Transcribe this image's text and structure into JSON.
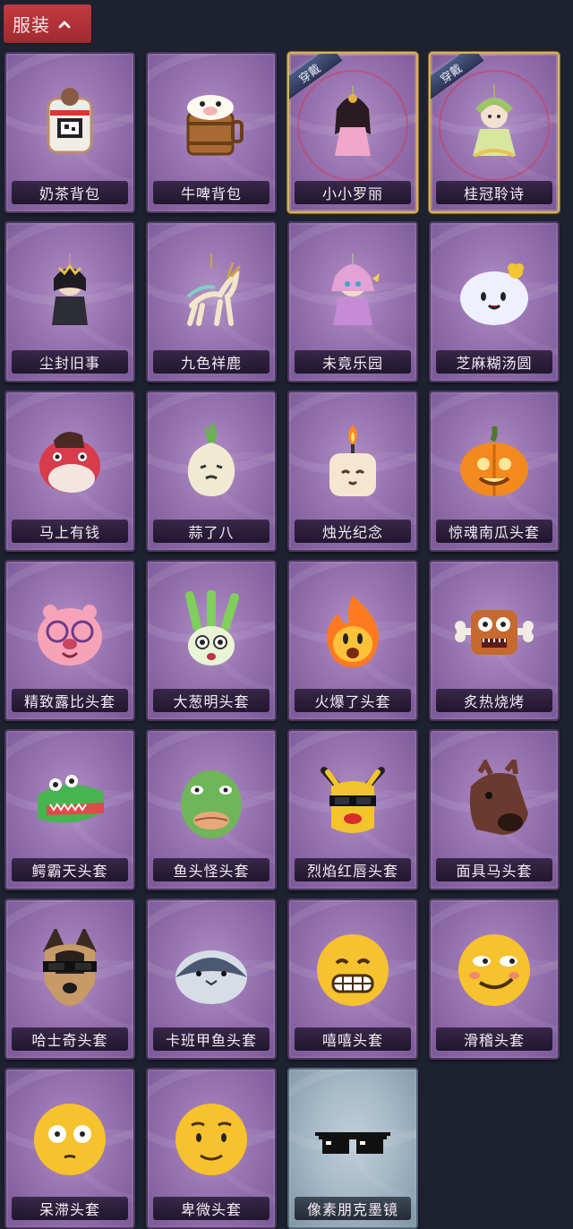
{
  "header": {
    "title": "服装",
    "toggle_icon": "chevron-up-icon"
  },
  "equipped_badge": "穿戴",
  "items": [
    {
      "name": "奶茶背包",
      "icon": "milk-tea-bag-icon",
      "color": "#e2c6a7",
      "equipped": false,
      "tone": "purple"
    },
    {
      "name": "牛啤背包",
      "icon": "beer-barrel-bag-icon",
      "color": "#c88a4a",
      "equipped": false,
      "tone": "purple"
    },
    {
      "name": "小小罗丽",
      "icon": "doll-charm-icon",
      "color": "#f0a7c9",
      "equipped": true,
      "tone": "purple"
    },
    {
      "name": "桂冠聆诗",
      "icon": "laurel-charm-icon",
      "color": "#d8e6a0",
      "equipped": true,
      "tone": "purple"
    },
    {
      "name": "尘封旧事",
      "icon": "gothic-doll-charm-icon",
      "color": "#2d2d35",
      "equipped": false,
      "tone": "purple"
    },
    {
      "name": "九色祥鹿",
      "icon": "deer-charm-icon",
      "color": "#f2e6c9",
      "equipped": false,
      "tone": "purple"
    },
    {
      "name": "未竟乐园",
      "icon": "clown-doll-charm-icon",
      "color": "#c68ad8",
      "equipped": false,
      "tone": "purple"
    },
    {
      "name": "芝麻糊汤圆",
      "icon": "dumpling-charm-icon",
      "color": "#eef0ff",
      "equipped": false,
      "tone": "purple"
    },
    {
      "name": "马上有钱",
      "icon": "horse-head-mask-icon",
      "color": "#d83b4b",
      "equipped": false,
      "tone": "purple"
    },
    {
      "name": "蒜了八",
      "icon": "garlic-mask-icon",
      "color": "#f0ead2",
      "equipped": false,
      "tone": "purple"
    },
    {
      "name": "烛光纪念",
      "icon": "candle-mask-icon",
      "color": "#f6e6cf",
      "equipped": false,
      "tone": "purple"
    },
    {
      "name": "惊魂南瓜头套",
      "icon": "pumpkin-mask-icon",
      "color": "#f28a1e",
      "equipped": false,
      "tone": "purple"
    },
    {
      "name": "精致露比头套",
      "icon": "pink-beaver-mask-icon",
      "color": "#f6a3b9",
      "equipped": false,
      "tone": "purple"
    },
    {
      "name": "大葱明头套",
      "icon": "scallion-mask-icon",
      "color": "#7fcf5a",
      "equipped": false,
      "tone": "purple"
    },
    {
      "name": "火爆了头套",
      "icon": "fire-mask-icon",
      "color": "#ff7a1f",
      "equipped": false,
      "tone": "purple"
    },
    {
      "name": "炙热烧烤",
      "icon": "meat-mask-icon",
      "color": "#c6692e",
      "equipped": false,
      "tone": "purple"
    },
    {
      "name": "鳄霸天头套",
      "icon": "crocodile-mask-icon",
      "color": "#47b44f",
      "equipped": false,
      "tone": "purple"
    },
    {
      "name": "鱼头怪头套",
      "icon": "fish-mask-icon",
      "color": "#6fb65a",
      "equipped": false,
      "tone": "purple"
    },
    {
      "name": "烈焰红唇头套",
      "icon": "yellow-hood-mask-icon",
      "color": "#f4c42e",
      "equipped": false,
      "tone": "purple"
    },
    {
      "name": "面具马头套",
      "icon": "horse-mask-icon",
      "color": "#6b3a2e",
      "equipped": false,
      "tone": "purple"
    },
    {
      "name": "哈士奇头套",
      "icon": "dog-mask-icon",
      "color": "#c79a67",
      "equipped": false,
      "tone": "purple"
    },
    {
      "name": "卡班甲鱼头套",
      "icon": "turtle-fish-mask-icon",
      "color": "#4a5872",
      "equipped": false,
      "tone": "purple"
    },
    {
      "name": "嘻嘻头套",
      "icon": "grin-emoji-mask-icon",
      "color": "#f6c22d",
      "equipped": false,
      "tone": "purple"
    },
    {
      "name": "滑稽头套",
      "icon": "funny-emoji-mask-icon",
      "color": "#f6c22d",
      "equipped": false,
      "tone": "purple"
    },
    {
      "name": "呆滞头套",
      "icon": "dazed-emoji-mask-icon",
      "color": "#f6c22d",
      "equipped": false,
      "tone": "purple"
    },
    {
      "name": "卑微头套",
      "icon": "humble-emoji-mask-icon",
      "color": "#f6c22d",
      "equipped": false,
      "tone": "purple"
    },
    {
      "name": "像素朋克墨镜",
      "icon": "pixel-sunglasses-icon",
      "color": "#111111",
      "equipped": false,
      "tone": "silver"
    }
  ]
}
